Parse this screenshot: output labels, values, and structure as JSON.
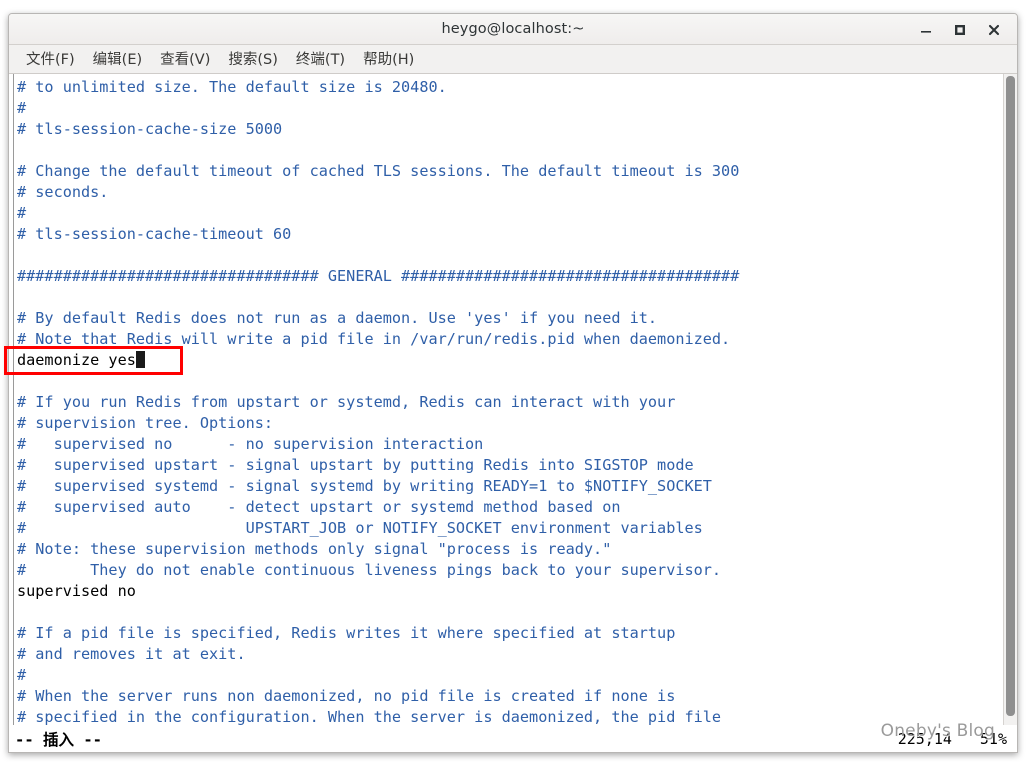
{
  "window": {
    "title": "heygo@localhost:~",
    "controls": [
      {
        "name": "minimize",
        "label": "–"
      },
      {
        "name": "maximize",
        "label": "□"
      },
      {
        "name": "close",
        "label": "✕"
      }
    ]
  },
  "menubar": {
    "items": [
      {
        "label": "文件(F)"
      },
      {
        "label": "编辑(E)"
      },
      {
        "label": "查看(V)"
      },
      {
        "label": "搜索(S)"
      },
      {
        "label": "终端(T)"
      },
      {
        "label": "帮助(H)"
      }
    ]
  },
  "editor": {
    "program": "vim",
    "filetype": "redis.conf",
    "comment_color": "#2f5fa8",
    "code_color": "#000000",
    "background": "#ffffff",
    "lines": [
      {
        "kind": "comment",
        "text": "# to unlimited size. The default size is 20480."
      },
      {
        "kind": "comment",
        "text": "#"
      },
      {
        "kind": "comment",
        "text": "# tls-session-cache-size 5000"
      },
      {
        "kind": "blank",
        "text": ""
      },
      {
        "kind": "comment",
        "text": "# Change the default timeout of cached TLS sessions. The default timeout is 300"
      },
      {
        "kind": "comment",
        "text": "# seconds."
      },
      {
        "kind": "comment",
        "text": "#"
      },
      {
        "kind": "comment",
        "text": "# tls-session-cache-timeout 60"
      },
      {
        "kind": "blank",
        "text": ""
      },
      {
        "kind": "comment",
        "text": "################################# GENERAL #####################################"
      },
      {
        "kind": "blank",
        "text": ""
      },
      {
        "kind": "comment",
        "text": "# By default Redis does not run as a daemon. Use 'yes' if you need it."
      },
      {
        "kind": "comment",
        "text": "# Note that Redis will write a pid file in /var/run/redis.pid when daemonized."
      },
      {
        "kind": "code",
        "text": "daemonize yes",
        "cursor_after": true
      },
      {
        "kind": "blank",
        "text": ""
      },
      {
        "kind": "comment",
        "text": "# If you run Redis from upstart or systemd, Redis can interact with your"
      },
      {
        "kind": "comment",
        "text": "# supervision tree. Options:"
      },
      {
        "kind": "comment",
        "text": "#   supervised no      - no supervision interaction"
      },
      {
        "kind": "comment",
        "text": "#   supervised upstart - signal upstart by putting Redis into SIGSTOP mode"
      },
      {
        "kind": "comment",
        "text": "#   supervised systemd - signal systemd by writing READY=1 to $NOTIFY_SOCKET"
      },
      {
        "kind": "comment",
        "text": "#   supervised auto    - detect upstart or systemd method based on"
      },
      {
        "kind": "comment",
        "text": "#                        UPSTART_JOB or NOTIFY_SOCKET environment variables"
      },
      {
        "kind": "comment",
        "text": "# Note: these supervision methods only signal \"process is ready.\""
      },
      {
        "kind": "comment",
        "text": "#       They do not enable continuous liveness pings back to your supervisor."
      },
      {
        "kind": "code",
        "text": "supervised no"
      },
      {
        "kind": "blank",
        "text": ""
      },
      {
        "kind": "comment",
        "text": "# If a pid file is specified, Redis writes it where specified at startup"
      },
      {
        "kind": "comment",
        "text": "# and removes it at exit."
      },
      {
        "kind": "comment",
        "text": "#"
      },
      {
        "kind": "comment",
        "text": "# When the server runs non daemonized, no pid file is created if none is"
      },
      {
        "kind": "comment",
        "text": "# specified in the configuration. When the server is daemonized, the pid file"
      }
    ]
  },
  "statusline": {
    "mode": "-- 插入 --",
    "position": "225,14",
    "percent": "51%"
  },
  "annotation": {
    "color": "#ff0000",
    "target_text": "daemonize yes"
  },
  "watermark": {
    "text": "Oneby's Blog"
  }
}
